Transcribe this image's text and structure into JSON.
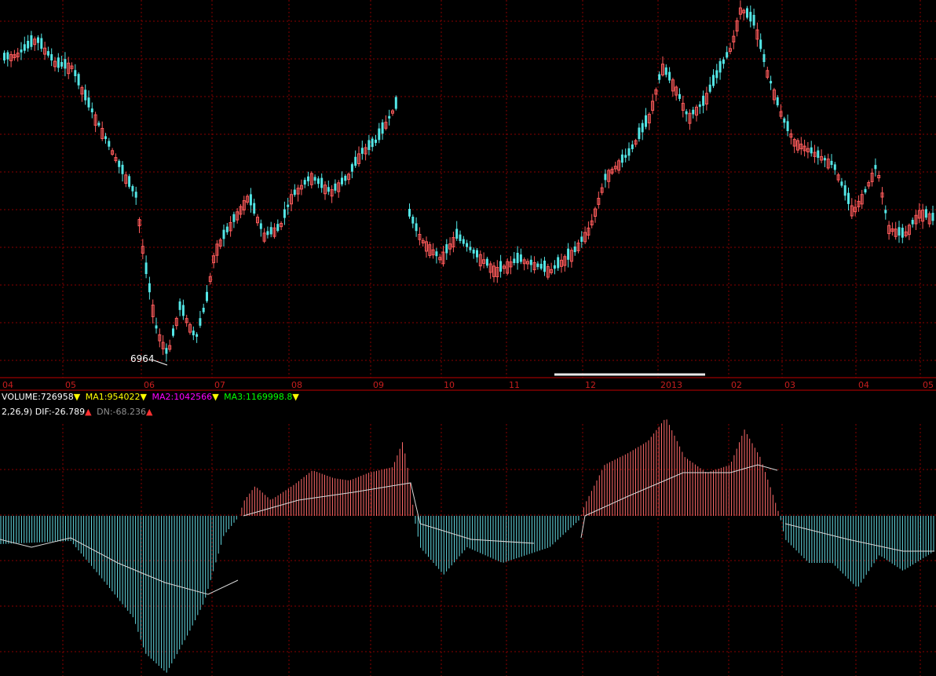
{
  "chart_data": [
    {
      "type": "candlestick",
      "x_ticks": [
        "04",
        "05",
        "06",
        "07",
        "08",
        "09",
        "10",
        "11",
        "12",
        "2013",
        "02",
        "03",
        "04",
        "05"
      ],
      "annotation": {
        "text": "6964",
        "value": 6964
      },
      "price_range": [
        6880,
        12240
      ],
      "colors": {
        "up": "#ff5b5b",
        "down": "#53e6e6",
        "grid": "#8a0000",
        "axis": "#c00000",
        "tick_text": "#c81e1e"
      }
    },
    {
      "type": "volume_legend",
      "items": [
        {
          "name": "VOLUME",
          "value": "726958",
          "color": "#ffffff",
          "arrow": "▼",
          "arrow_color": "#ffff00"
        },
        {
          "name": "MA1",
          "value": "954022",
          "color": "#ffff00",
          "arrow": "▼",
          "arrow_color": "#ffff00"
        },
        {
          "name": "MA2",
          "value": "1042566",
          "color": "#ff00ff",
          "arrow": "▼",
          "arrow_color": "#ffff00"
        },
        {
          "name": "MA3",
          "value": "1169998.8",
          "color": "#00ff00",
          "arrow": "▼",
          "arrow_color": "#ffff00"
        }
      ]
    },
    {
      "type": "macd",
      "prefix": "2,26,9)",
      "items": [
        {
          "name": "DIF",
          "value": "-26.789",
          "arrow": "▲"
        },
        {
          "name": "DN",
          "value": "-68.236",
          "arrow": "▲"
        }
      ],
      "colors": {
        "pos": "#ff6a6a",
        "neg": "#62d8e0",
        "line": "#d8d8d8"
      },
      "bars": [
        {
          "x": 0,
          "h": -36
        },
        {
          "x": 90,
          "h": -32
        },
        {
          "x": 130,
          "h": -80
        },
        {
          "x": 170,
          "h": -130
        },
        {
          "x": 185,
          "h": -175
        },
        {
          "x": 212,
          "h": -200
        },
        {
          "x": 240,
          "h": -150
        },
        {
          "x": 260,
          "h": -110
        },
        {
          "x": 285,
          "h": -25
        },
        {
          "x": 305,
          "h": 0
        },
        {
          "x": 310,
          "h": 18
        },
        {
          "x": 325,
          "h": 38
        },
        {
          "x": 345,
          "h": 20
        },
        {
          "x": 375,
          "h": 40
        },
        {
          "x": 398,
          "h": 58
        },
        {
          "x": 425,
          "h": 48
        },
        {
          "x": 445,
          "h": 45
        },
        {
          "x": 470,
          "h": 55
        },
        {
          "x": 500,
          "h": 62
        },
        {
          "x": 513,
          "h": 95
        },
        {
          "x": 522,
          "h": 45
        },
        {
          "x": 528,
          "h": -5
        },
        {
          "x": 535,
          "h": -40
        },
        {
          "x": 565,
          "h": -75
        },
        {
          "x": 595,
          "h": -40
        },
        {
          "x": 640,
          "h": -60
        },
        {
          "x": 700,
          "h": -40
        },
        {
          "x": 738,
          "h": -5
        },
        {
          "x": 745,
          "h": 15
        },
        {
          "x": 770,
          "h": 65
        },
        {
          "x": 800,
          "h": 80
        },
        {
          "x": 825,
          "h": 95
        },
        {
          "x": 848,
          "h": 125
        },
        {
          "x": 872,
          "h": 75
        },
        {
          "x": 900,
          "h": 55
        },
        {
          "x": 930,
          "h": 65
        },
        {
          "x": 948,
          "h": 110
        },
        {
          "x": 968,
          "h": 75
        },
        {
          "x": 985,
          "h": 25
        },
        {
          "x": 993,
          "h": 0
        },
        {
          "x": 1000,
          "h": -30
        },
        {
          "x": 1030,
          "h": -60
        },
        {
          "x": 1060,
          "h": -60
        },
        {
          "x": 1092,
          "h": -92
        },
        {
          "x": 1120,
          "h": -50
        },
        {
          "x": 1150,
          "h": -70
        },
        {
          "x": 1190,
          "h": -45
        }
      ],
      "signal": [
        {
          "x": 0,
          "h": -30
        },
        {
          "x": 40,
          "h": -40
        },
        {
          "x": 90,
          "h": -28
        },
        {
          "x": 150,
          "h": -60
        },
        {
          "x": 210,
          "h": -85
        },
        {
          "x": 265,
          "h": -100
        },
        {
          "x": 303,
          "h": -82
        },
        {
          "x": 310,
          "h": 0
        },
        {
          "x": 380,
          "h": 20
        },
        {
          "x": 450,
          "h": 30
        },
        {
          "x": 523,
          "h": 42
        },
        {
          "x": 535,
          "h": -10
        },
        {
          "x": 600,
          "h": -30
        },
        {
          "x": 680,
          "h": -35
        },
        {
          "x": 740,
          "h": -28
        },
        {
          "x": 745,
          "h": 0
        },
        {
          "x": 800,
          "h": 25
        },
        {
          "x": 870,
          "h": 55
        },
        {
          "x": 930,
          "h": 55
        },
        {
          "x": 965,
          "h": 65
        },
        {
          "x": 990,
          "h": 58
        },
        {
          "x": 1000,
          "h": -10
        },
        {
          "x": 1080,
          "h": -30
        },
        {
          "x": 1150,
          "h": -45
        },
        {
          "x": 1190,
          "h": -45
        }
      ]
    }
  ]
}
